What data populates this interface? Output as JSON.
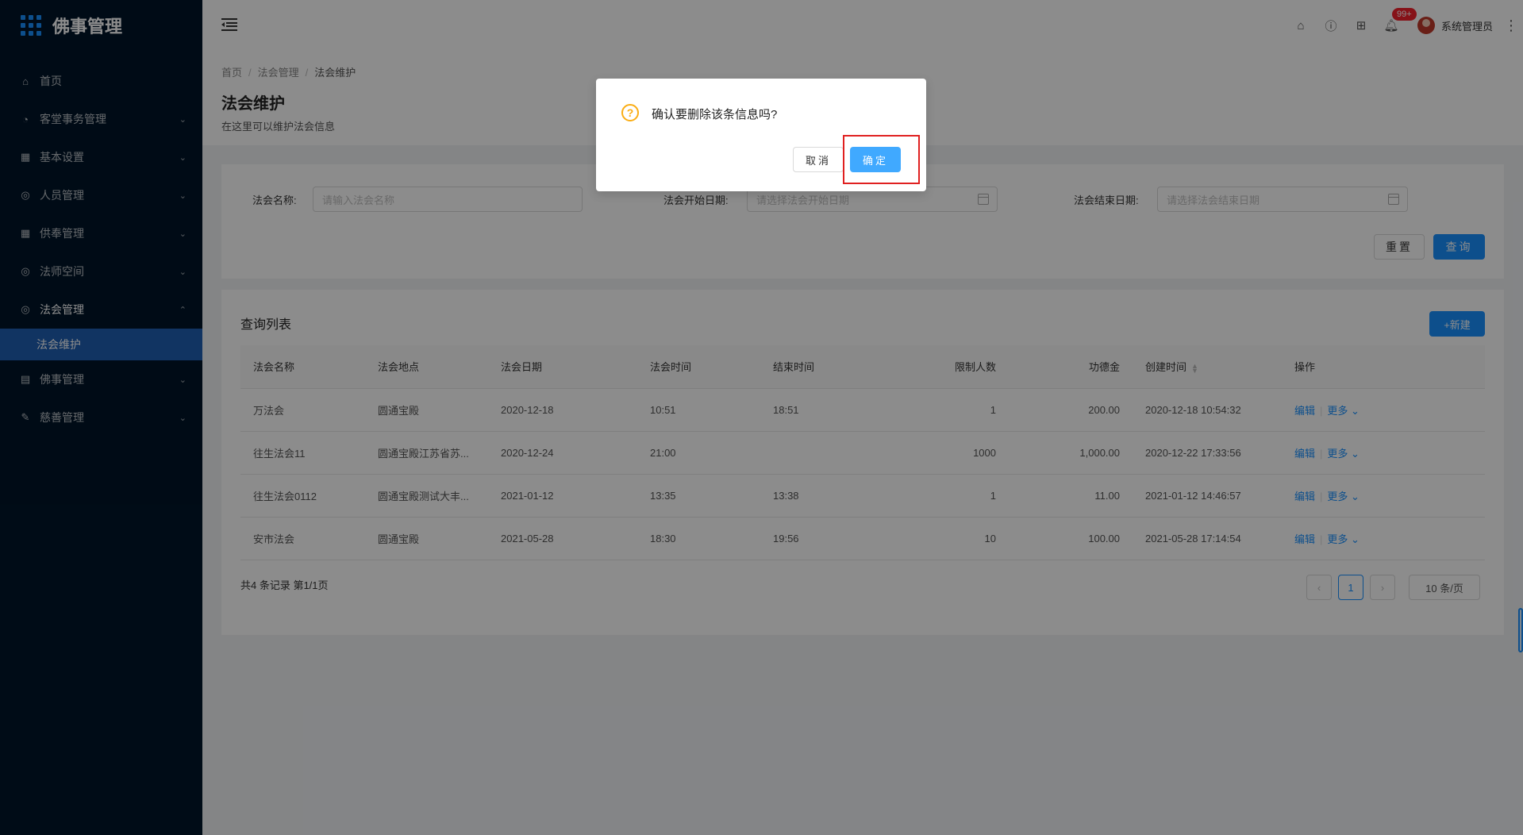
{
  "app": {
    "title": "佛事管理"
  },
  "sidebar": {
    "items": [
      {
        "label": "首页",
        "icon": "home-icon",
        "arrow": ""
      },
      {
        "label": "客堂事务管理",
        "icon": "dashboard-icon",
        "arrow": "⌄"
      },
      {
        "label": "基本设置",
        "icon": "table-icon",
        "arrow": "⌄"
      },
      {
        "label": "人员管理",
        "icon": "check-circle-icon",
        "arrow": "⌄"
      },
      {
        "label": "供奉管理",
        "icon": "table-icon",
        "arrow": "⌄"
      },
      {
        "label": "法师空间",
        "icon": "check-circle-icon",
        "arrow": "⌄"
      },
      {
        "label": "法会管理",
        "icon": "check-circle-icon",
        "arrow": "⌃"
      },
      {
        "label": "佛事管理",
        "icon": "profile-icon",
        "arrow": "⌄"
      },
      {
        "label": "慈善管理",
        "icon": "edit-icon",
        "arrow": "⌄"
      }
    ],
    "active_sub": "法会维护"
  },
  "header": {
    "badge": "99+",
    "username": "系统管理员"
  },
  "breadcrumb": {
    "home": "首页",
    "parent": "法会管理",
    "current": "法会维护"
  },
  "page": {
    "title": "法会维护",
    "description": "在这里可以维护法会信息"
  },
  "search": {
    "name_label": "法会名称:",
    "name_placeholder": "请输入法会名称",
    "start_label": "法会开始日期:",
    "start_placeholder": "请选择法会开始日期",
    "end_label": "法会结束日期:",
    "end_placeholder": "请选择法会结束日期",
    "reset": "重置",
    "query": "查询"
  },
  "list": {
    "title": "查询列表",
    "new_button": "+新建",
    "columns": [
      "法会名称",
      "法会地点",
      "法会日期",
      "法会时间",
      "结束时间",
      "限制人数",
      "功德金",
      "创建时间",
      "操作"
    ],
    "rows": [
      [
        "万法会",
        "圆通宝殿",
        "2020-12-18",
        "10:51",
        "18:51",
        "1",
        "200.00",
        "2020-12-18 10:54:32"
      ],
      [
        "往生法会11",
        "圆通宝殿江苏省苏...",
        "2020-12-24",
        "21:00",
        "",
        "1000",
        "1,000.00",
        "2020-12-22 17:33:56"
      ],
      [
        "往生法会0112",
        "圆通宝殿测试大丰...",
        "2021-01-12",
        "13:35",
        "13:38",
        "1",
        "11.00",
        "2021-01-12 14:46:57"
      ],
      [
        "安市法会",
        "圆通宝殿",
        "2021-05-28",
        "18:30",
        "19:56",
        "10",
        "100.00",
        "2021-05-28 17:14:54"
      ]
    ],
    "edit": "编辑",
    "more": "更多 ⌄",
    "summary": "共4 条记录 第1/1页",
    "page": "1",
    "page_size": "10 条/页"
  },
  "modal": {
    "message": "确认要删除该条信息吗?",
    "cancel": "取消",
    "ok": "确定"
  }
}
